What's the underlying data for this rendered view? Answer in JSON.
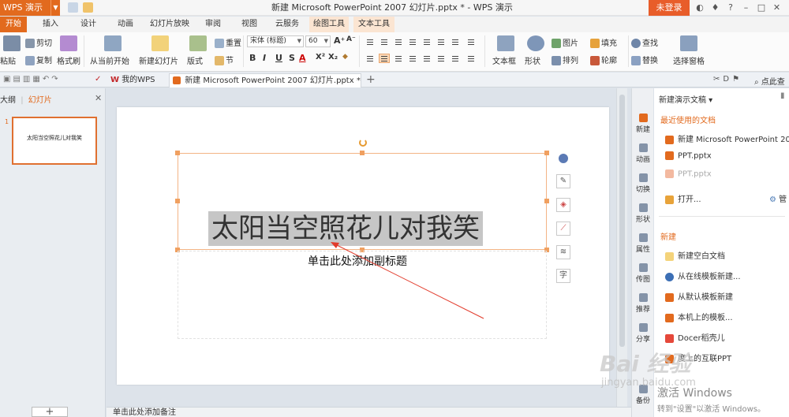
{
  "app": {
    "menu_button": "WPS 演示",
    "window_title": "新建 Microsoft PowerPoint 2007 幻灯片.pptx * - WPS 演示",
    "login_button": "未登录",
    "accent_color": "#e26a1e"
  },
  "ribbon_tabs": [
    {
      "label": "开始",
      "active": true
    },
    {
      "label": "插入"
    },
    {
      "label": "设计"
    },
    {
      "label": "动画"
    },
    {
      "label": "幻灯片放映"
    },
    {
      "label": "审阅"
    },
    {
      "label": "视图"
    },
    {
      "label": "云服务"
    },
    {
      "label": "绘图工具",
      "contextual": true
    },
    {
      "label": "文本工具",
      "contextual": true
    }
  ],
  "ribbon": {
    "paste": "粘贴",
    "cut": "剪切",
    "copy": "复制",
    "format_painter": "格式刷",
    "from_current": "从当前开始",
    "new_slide": "新建幻灯片",
    "layout": "版式",
    "reset": "重置",
    "section": "节",
    "font_name": "宋体 (标题)",
    "font_size": "60",
    "textbox": "文本框",
    "shape": "形状",
    "picture": "图片",
    "arrange": "排列",
    "fill": "填充",
    "outline": "轮廓",
    "find": "查找",
    "replace": "替换",
    "select_pane": "选择窗格"
  },
  "doc_tabs": {
    "mywps": "我的WPS",
    "current": "新建 Microsoft PowerPoint 2007 幻灯片.pptx *",
    "right_label": "点此查"
  },
  "left_panel": {
    "tab_outline": "大纲",
    "tab_slides": "幻灯片",
    "slide_number": "1",
    "thumb_text": "太阳当空照花儿对我笑"
  },
  "slide": {
    "title": "太阳当空照花儿对我笑",
    "subtitle": "单击此处添加副标题"
  },
  "float_tools": {
    "text_tool": "字"
  },
  "notes": "单击此处添加备注",
  "sidebar": [
    {
      "label": "新建",
      "color": "#e26a1e"
    },
    {
      "label": "动画",
      "color": "#6b7c93"
    },
    {
      "label": "切换",
      "color": "#6b7c93"
    },
    {
      "label": "形状",
      "color": "#6b7c93"
    },
    {
      "label": "属性",
      "color": "#6b7c93"
    },
    {
      "label": "传图",
      "color": "#6b7c93"
    },
    {
      "label": "推荐",
      "color": "#6b7c93"
    },
    {
      "label": "分享",
      "color": "#6b7c93"
    },
    {
      "label": "备份",
      "color": "#6b7c93"
    }
  ],
  "taskpane": {
    "header": "新建演示文稿 ▾",
    "recent_title": "最近使用的文档",
    "recent": [
      {
        "label": "新建 Microsoft PowerPoint 2007"
      },
      {
        "label": "PPT.pptx"
      },
      {
        "label": "PPT.pptx",
        "faded": true
      }
    ],
    "open": "打开...",
    "manage": "管",
    "new_title": "新建",
    "new_items": [
      {
        "label": "新建空白文档"
      },
      {
        "label": "从在线模板新建..."
      },
      {
        "label": "从默认模板新建"
      },
      {
        "label": "本机上的模板..."
      },
      {
        "label": "Docer稻壳儿"
      },
      {
        "label": "度上的互联PPT"
      }
    ]
  },
  "watermark": {
    "activate": "激活 Windows",
    "activate_hint": "转到\"设置\"以激活 Windows。",
    "baidu": "Bai 经验",
    "baidu_url": "jingyan.baidu.com"
  }
}
